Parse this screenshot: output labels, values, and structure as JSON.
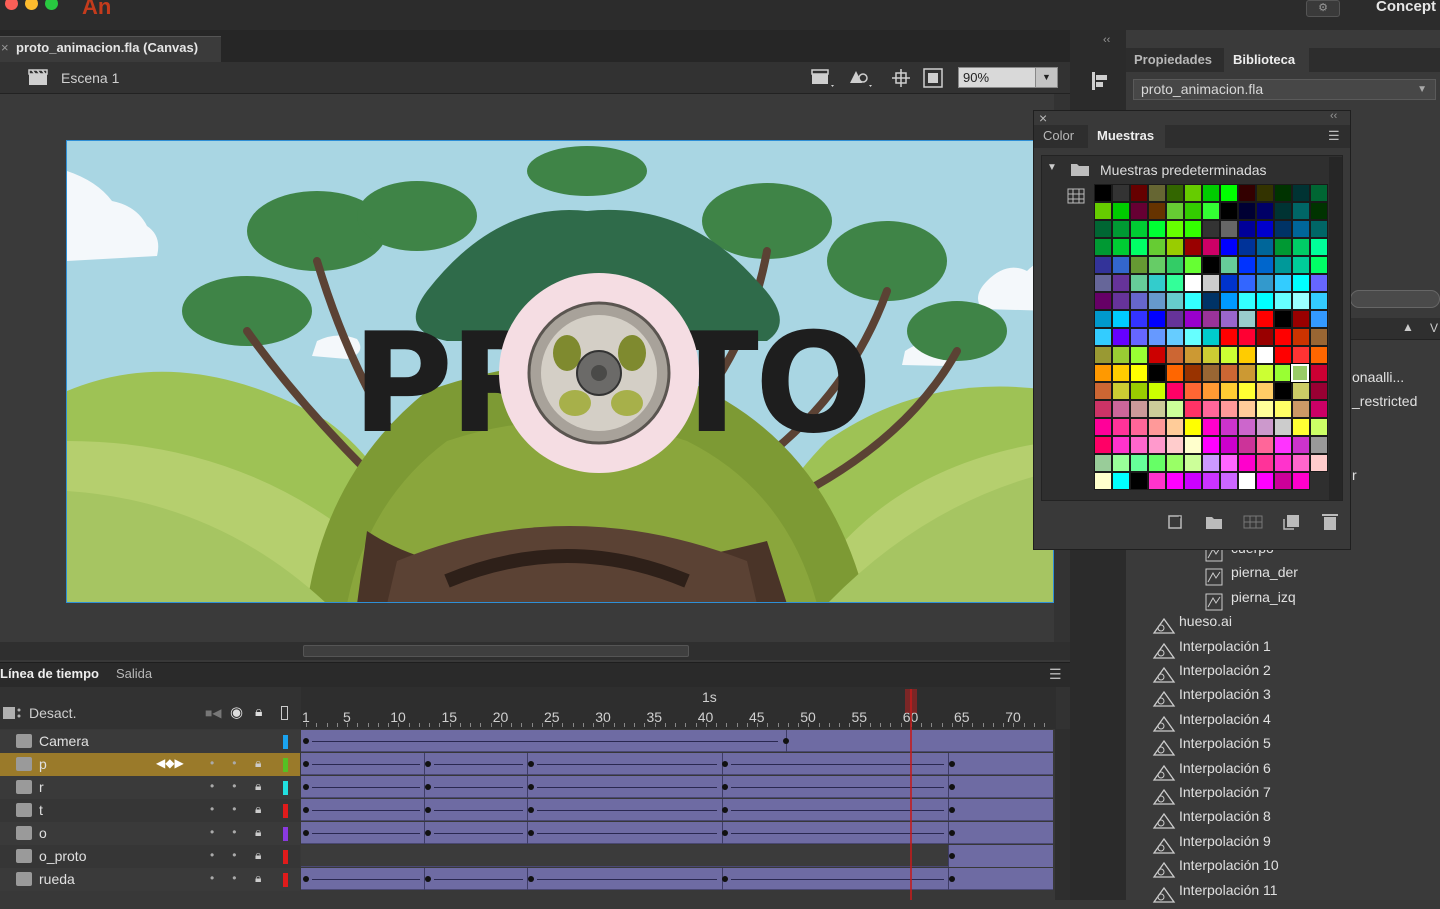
{
  "titlebar": {
    "app_logo": "An",
    "workspace": "Concept",
    "ws_icon": "⚙"
  },
  "document": {
    "tab_label": "proto_animacion.fla (Canvas)",
    "close": "×"
  },
  "edit_bar": {
    "scene": "Escena 1",
    "zoom": "90%"
  },
  "stage": {
    "logo_text": "PROTO"
  },
  "timeline": {
    "tabs": [
      "Línea de tiempo",
      "Salida"
    ],
    "onion_label": "Desact.",
    "second_marker": "1s",
    "ticks": [
      "1",
      "5",
      "10",
      "15",
      "20",
      "25",
      "30",
      "35",
      "40",
      "45",
      "50",
      "55",
      "60",
      "65",
      "70"
    ],
    "current_frame": 60,
    "layers": [
      {
        "name": "Camera",
        "color": "#1aa3f0"
      },
      {
        "name": "p",
        "color": "#55c023"
      },
      {
        "name": "r",
        "color": "#21e0e0"
      },
      {
        "name": "t",
        "color": "#e01b1b"
      },
      {
        "name": "o",
        "color": "#8a3ae0"
      },
      {
        "name": "o_proto",
        "color": "#e01b1b"
      },
      {
        "name": "rueda",
        "color": "#e01b1b"
      }
    ]
  },
  "right_panel": {
    "tabs": [
      "Propiedades",
      "Biblioteca"
    ],
    "library_select": "proto_animacion.fla",
    "partial_items": [
      "onaalli...",
      "_restricted",
      "r"
    ],
    "items": [
      "cuerpo",
      "pierna_der",
      "pierna_izq",
      "hueso.ai",
      "Interpolación 1",
      "Interpolación 2",
      "Interpolación 3",
      "Interpolación 4",
      "Interpolación 5",
      "Interpolación 6",
      "Interpolación 7",
      "Interpolación 8",
      "Interpolación 9",
      "Interpolación 10",
      "Interpolación 11"
    ]
  },
  "swatches_panel": {
    "tabs": [
      "Color",
      "Muestras"
    ],
    "folder": "Muestras predeterminadas",
    "close": "×",
    "collapse": "‹‹"
  },
  "colors": {
    "accent_blue": "#2e8fd6",
    "playhead": "#c41b1b",
    "selected_layer": "#9a7a2a",
    "tween": "#6e6ba3"
  }
}
